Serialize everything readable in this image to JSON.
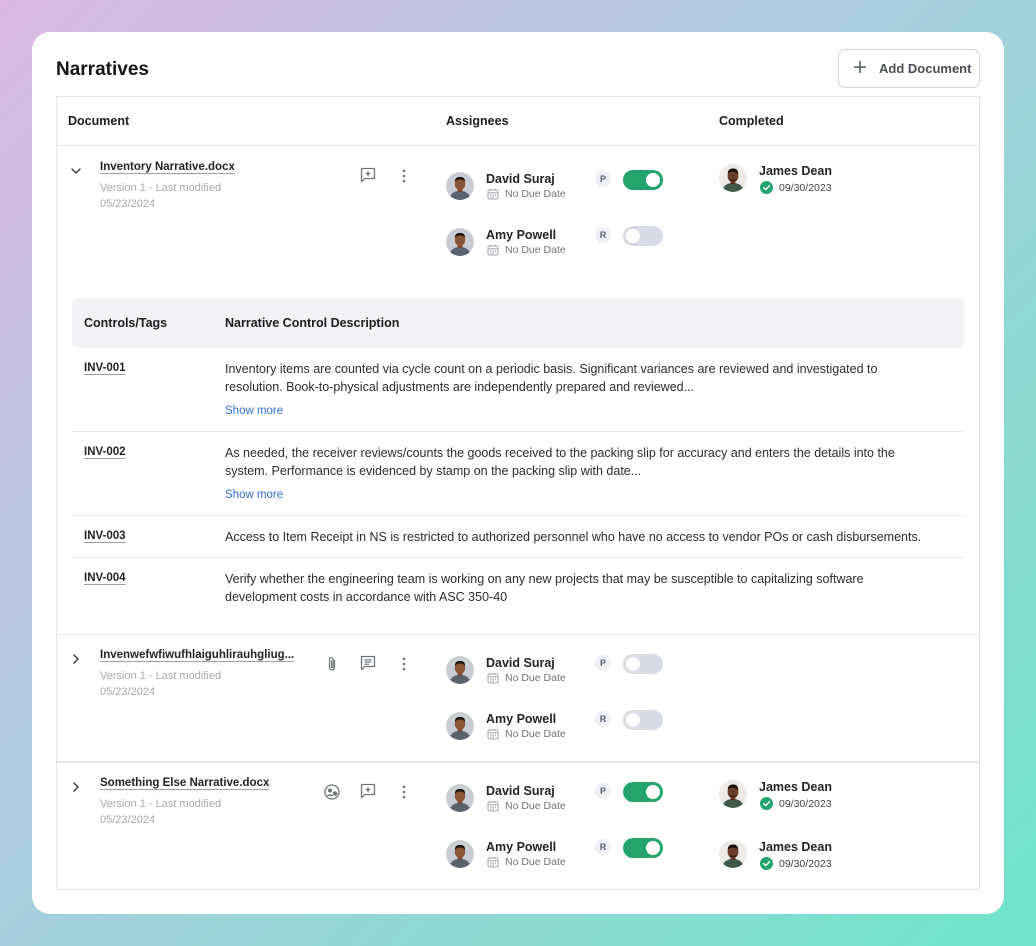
{
  "page": {
    "title": "Narratives",
    "add_button": "Add Document"
  },
  "columns": {
    "document": "Document",
    "assignees": "Assignees",
    "completed": "Completed"
  },
  "documents": [
    {
      "name": "Inventory Narrative.docx",
      "version": "Version 1 - Last modified",
      "modified": "05/23/2024",
      "expanded": true,
      "assignees": [
        {
          "name": "David Suraj",
          "due": "No Due Date",
          "role": "P",
          "enabled": true
        },
        {
          "name": "Amy Powell",
          "due": "No Due Date",
          "role": "R",
          "enabled": false
        }
      ],
      "completed": [
        {
          "name": "James Dean",
          "date": "09/30/2023"
        }
      ]
    },
    {
      "name": "Invenwefwfiwufhlaiguhlirauhgliug...",
      "version": "Version 1 - Last modified",
      "modified": "05/23/2024",
      "expanded": false,
      "assignees": [
        {
          "name": "David Suraj",
          "due": "No Due Date",
          "role": "P",
          "enabled": false
        },
        {
          "name": "Amy Powell",
          "due": "No Due Date",
          "role": "R",
          "enabled": false
        }
      ],
      "completed": []
    },
    {
      "name": "Something Else Narrative.docx",
      "version": "Version 1 - Last modified",
      "modified": "05/23/2024",
      "expanded": false,
      "assignees": [
        {
          "name": "David Suraj",
          "due": "No Due Date",
          "role": "P",
          "enabled": true
        },
        {
          "name": "Amy Powell",
          "due": "No Due Date",
          "role": "R",
          "enabled": true
        }
      ],
      "completed": [
        {
          "name": "James Dean",
          "date": "09/30/2023"
        },
        {
          "name": "James Dean",
          "date": "09/30/2023"
        }
      ]
    }
  ],
  "controls": {
    "headers": {
      "tags": "Controls/Tags",
      "description": "Narrative Control Description"
    },
    "show_more": "Show more",
    "rows": [
      {
        "id": "INV-001",
        "line1": "Inventory items are counted via cycle count on a periodic basis. Significant variances are reviewed and investigated to",
        "line2": "resolution. Book-to-physical adjustments are independently prepared and reviewed..."
      },
      {
        "id": "INV-002",
        "line1": "As needed, the receiver reviews/counts the goods received to the packing slip for accuracy and enters the details into the",
        "line2": "system. Performance is evidenced by stamp on the packing slip with date..."
      },
      {
        "id": "INV-003",
        "line1": "Access to Item Receipt in NS is restricted to authorized personnel who have no access to vendor POs or cash disbursements."
      },
      {
        "id": "INV-004",
        "line1": "Verify whether the engineering team is working on any new projects that may be susceptible to capitalizing software",
        "line2": "development costs in accordance with ASC 350-40"
      }
    ]
  },
  "icons": [
    "plus-icon",
    "chevron-down-icon",
    "chevron-right-icon",
    "comment-add-icon",
    "comment-icon",
    "more-vertical-icon",
    "paperclip-icon",
    "user-circle-icon",
    "calendar-icon",
    "check-circle-icon"
  ],
  "colors": {
    "toggle_on": "#23a46c",
    "toggle_off": "#d9dce5",
    "link": "#2f6fd6"
  }
}
